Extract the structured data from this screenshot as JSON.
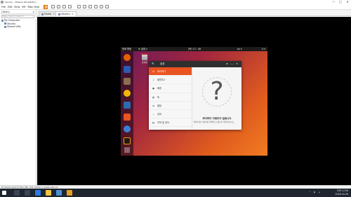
{
  "window": {
    "title": "Ubuntu - VMware Workstation",
    "min": "—",
    "max": "□",
    "close": "✕"
  },
  "menu": [
    "File",
    "Edit",
    "View",
    "VM",
    "Tabs",
    "Help"
  ],
  "library": {
    "title": "Library",
    "close": "×",
    "search_placeholder": "Type here to search",
    "tree": [
      {
        "label": "My Computer",
        "level": 0
      },
      {
        "label": "Ubuntu",
        "level": 1
      },
      {
        "label": "Shared VMs",
        "level": 1
      }
    ]
  },
  "tabs": [
    {
      "label": "Home",
      "active": false
    },
    {
      "label": "Ubuntu",
      "active": true
    }
  ],
  "status_text": "To direct input to this VM, click inside or press Ctrl+G.",
  "taskbar": {
    "time": "오후 12:06",
    "date": "2018-04-26"
  },
  "guest": {
    "topbar": {
      "activities": "현재 활동",
      "app_menu": "⚙ 설정 ▾",
      "clock": "(목) 12 : 06",
      "indicator": "ko ▾",
      "power": "⏻ ▾"
    },
    "trash_label": "휴지통",
    "dock": [
      {
        "name": "firefox",
        "color": "#e66000"
      },
      {
        "name": "thunderbird",
        "color": "#2a5bb5"
      },
      {
        "name": "files",
        "color": "#8c6d4f"
      },
      {
        "name": "rhythmbox",
        "color": "#f2b705"
      },
      {
        "name": "writer",
        "color": "#2b6cb0"
      },
      {
        "name": "software",
        "color": "#e95420"
      },
      {
        "name": "help",
        "color": "#3d7fd8"
      },
      {
        "name": "amazon",
        "color": "#1a1a1a"
      }
    ],
    "settings": {
      "title": "설정",
      "search": "🔍",
      "controls": [
        "≡",
        "—",
        "✕"
      ],
      "sidebar": [
        {
          "icon": "❦",
          "label": "와이파이",
          "active": true
        },
        {
          "icon": "ᛒ",
          "label": "블루투스",
          "active": false
        },
        {
          "icon": "▣",
          "label": "배경",
          "active": false
        },
        {
          "icon": "▤",
          "label": "독",
          "active": false
        },
        {
          "icon": "◔",
          "label": "알림",
          "active": false
        },
        {
          "icon": "⌕",
          "label": "검색",
          "active": false
        },
        {
          "icon": "▥",
          "label": "지역 및 언어",
          "active": false
        }
      ],
      "no_hw_title": "와이파이 어댑터가 없습니다",
      "no_hw_desc": "와이파이 어댑터를 연결하고 켰는지 확인하십시오"
    }
  }
}
